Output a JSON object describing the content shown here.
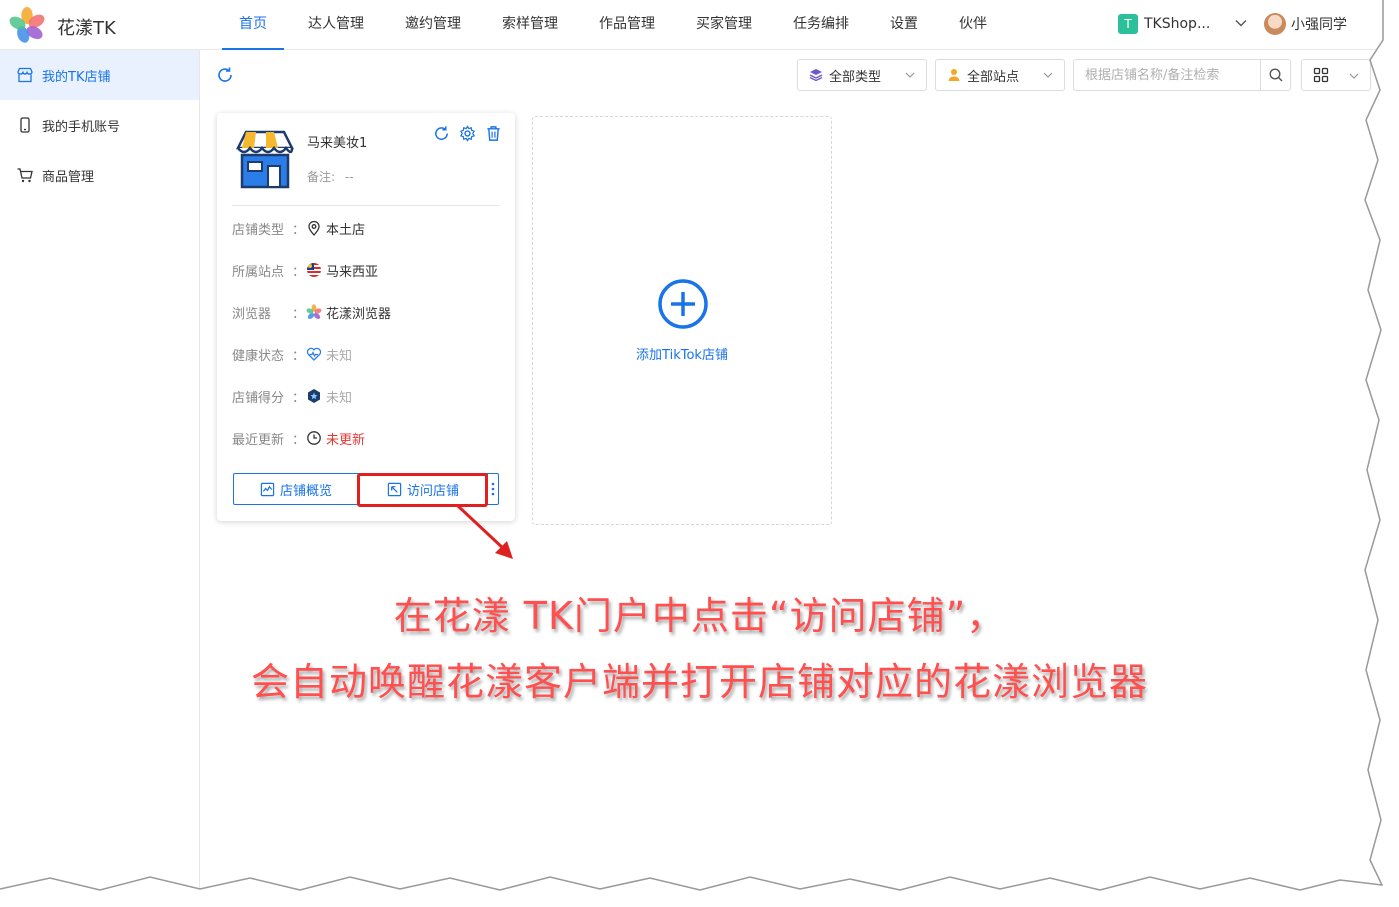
{
  "brand": {
    "name": "花漾TK"
  },
  "nav": {
    "items": [
      {
        "label": "首页",
        "active": true
      },
      {
        "label": "达人管理"
      },
      {
        "label": "邀约管理"
      },
      {
        "label": "索样管理"
      },
      {
        "label": "作品管理"
      },
      {
        "label": "买家管理"
      },
      {
        "label": "任务编排"
      },
      {
        "label": "设置"
      },
      {
        "label": "伙伴"
      }
    ]
  },
  "team": {
    "badge": "T",
    "name": "TKShop..."
  },
  "user": {
    "name": "小强同学"
  },
  "sidebar": {
    "items": [
      {
        "label": "我的TK店铺",
        "icon": "shop-icon",
        "active": true
      },
      {
        "label": "我的手机账号",
        "icon": "phone-icon"
      },
      {
        "label": "商品管理",
        "icon": "cart-icon"
      }
    ]
  },
  "toolbar": {
    "type_filter": "全部类型",
    "site_filter": "全部站点",
    "search_placeholder": "根据店铺名称/备注检索"
  },
  "store_card": {
    "name": "马来美妆1",
    "note_label": "备注:",
    "note_value": "--",
    "rows": [
      {
        "label": "店铺类型",
        "colon": "：",
        "value": "本土店",
        "icon": "location-pin-icon"
      },
      {
        "label": "所属站点",
        "colon": "：",
        "value": "马来西亚",
        "icon": "malaysia-flag-icon"
      },
      {
        "label": "浏览器",
        "colon": "：",
        "value": "花漾浏览器",
        "icon": "huayang-browser-icon"
      },
      {
        "label": "健康状态",
        "colon": "：",
        "value": "未知",
        "icon": "health-heart-icon"
      },
      {
        "label": "店铺得分",
        "colon": "：",
        "value": "未知",
        "icon": "score-badge-icon"
      },
      {
        "label": "最近更新",
        "colon": "：",
        "value": "未更新",
        "icon": "clock-icon"
      }
    ],
    "overview_button": "店铺概览",
    "visit_button": "访问店铺"
  },
  "add_card": {
    "label": "添加TikTok店铺"
  },
  "caption": {
    "line1": "在花漾 TK门户中点击“访问店铺”，",
    "line2": "会自动唤醒花漾客户端并打开店铺对应的花漾浏览器"
  },
  "colors": {
    "accent": "#1a73e8",
    "annotation": "#e02020",
    "caption": "#ff4f4f",
    "status_red": "#e53935"
  }
}
